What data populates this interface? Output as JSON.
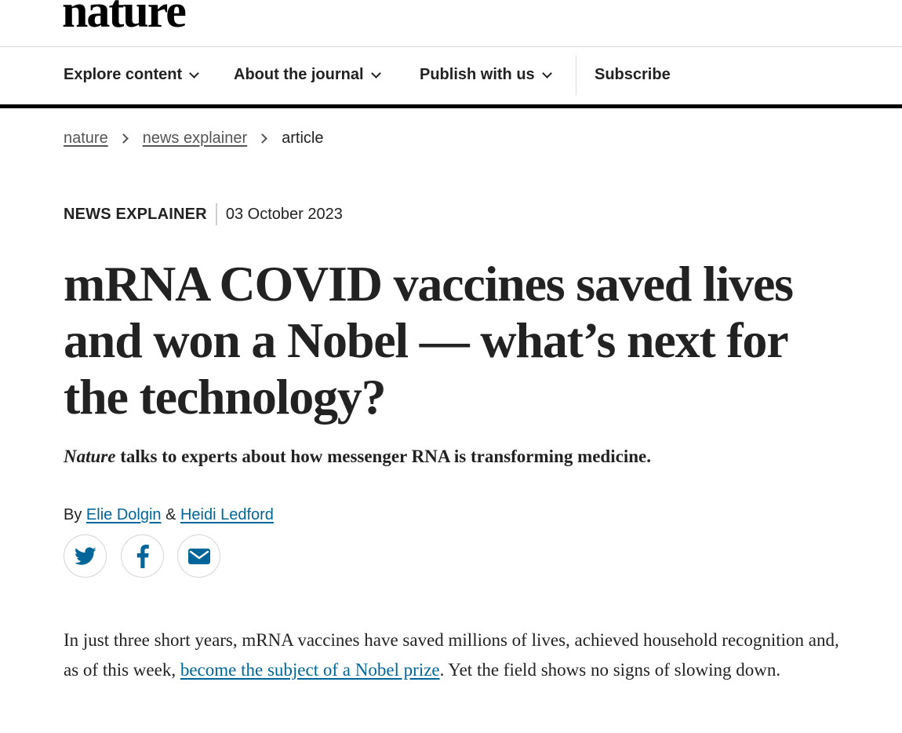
{
  "site": {
    "logo_text": "nature"
  },
  "nav": {
    "items": [
      {
        "label": "Explore content"
      },
      {
        "label": "About the journal"
      },
      {
        "label": "Publish with us"
      }
    ],
    "subscribe_label": "Subscribe"
  },
  "breadcrumb": {
    "items": [
      "nature",
      "news explainer"
    ],
    "current": "article"
  },
  "article": {
    "type": "NEWS EXPLAINER",
    "date": "03 October 2023",
    "title": "mRNA COVID vaccines saved lives and won a Nobel — what’s next for the technology?",
    "standfirst_em": "Nature",
    "standfirst_rest": " talks to experts about how messenger RNA is transforming medicine.",
    "byline_prefix": "By ",
    "authors": [
      "Elie Dolgin",
      "Heidi Ledford"
    ],
    "author_sep": " & ",
    "share_icons": [
      "twitter-icon",
      "facebook-icon",
      "email-icon"
    ],
    "body_before_link": "In just three short years, mRNA vaccines have saved millions of lives, achieved household recognition and, as of this week, ",
    "body_link": "become the subject of a Nobel prize",
    "body_after_link": ". Yet the field shows no signs of slowing down."
  },
  "colors": {
    "link": "#006699",
    "text": "#222222",
    "rule": "#000000"
  }
}
